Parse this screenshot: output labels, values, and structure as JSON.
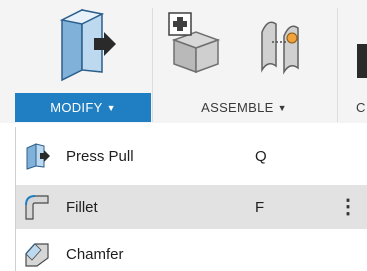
{
  "toolbar": {
    "groups": [
      {
        "label": "MODIFY",
        "active": true
      },
      {
        "label": "ASSEMBLE",
        "active": false
      },
      {
        "label": "C",
        "active": false
      }
    ],
    "tools": [
      {
        "icon": "press-pull-large-icon"
      },
      {
        "icon": "new-component-icon"
      },
      {
        "icon": "joint-icon"
      }
    ]
  },
  "menu": {
    "items": [
      {
        "label": "Press Pull",
        "shortcut": "Q",
        "icon": "press-pull-icon",
        "highlighted": false
      },
      {
        "label": "Fillet",
        "shortcut": "F",
        "icon": "fillet-icon",
        "highlighted": true,
        "more": "⋮"
      },
      {
        "label": "Chamfer",
        "shortcut": "",
        "icon": "chamfer-icon",
        "highlighted": false
      }
    ]
  },
  "colors": {
    "accent": "#1f7fc2",
    "toolbar_bg": "#f4f4f4",
    "hover_bg": "#e2e2e2"
  }
}
